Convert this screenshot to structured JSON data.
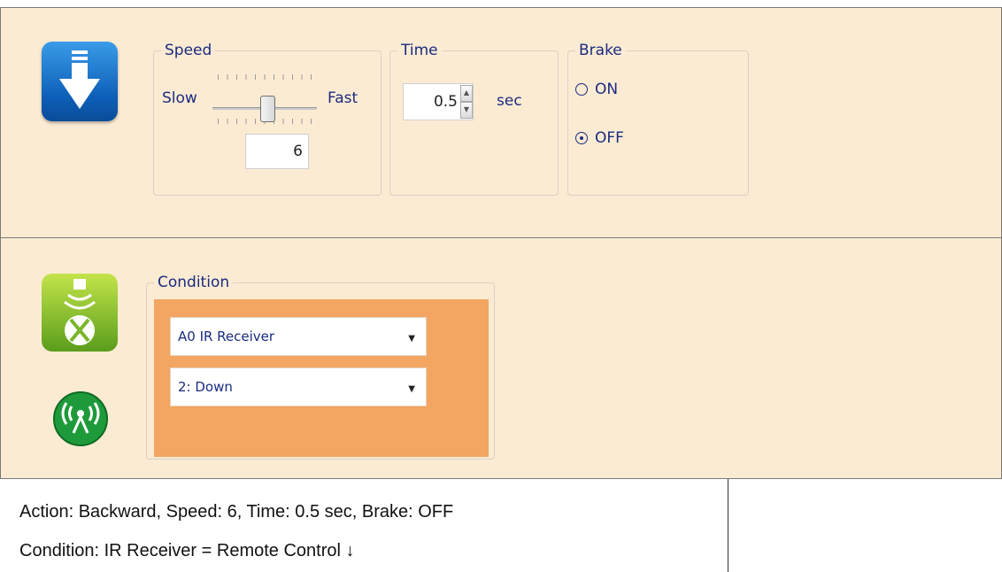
{
  "action_panel": {
    "action_icon": "backward-arrow-icon",
    "speed": {
      "legend": "Speed",
      "slow_label": "Slow",
      "fast_label": "Fast",
      "value": "6",
      "slider_level": 6
    },
    "time": {
      "legend": "Time",
      "value": "0.5",
      "unit": "sec"
    },
    "brake": {
      "legend": "Brake",
      "options": [
        "ON",
        "OFF"
      ],
      "selected": "OFF"
    }
  },
  "condition_panel": {
    "sensor_icon": "ir-receiver-icon",
    "remote_icon": "remote-signal-icon",
    "legend": "Condition",
    "port_select": "A0 IR Receiver",
    "value_select": "2: Down"
  },
  "description": {
    "line1": "Action: Backward, Speed: 6, Time: 0.5 sec, Brake: OFF",
    "line2": "Condition: IR Receiver = Remote Control ↓"
  },
  "colors": {
    "panel_bg": "#fcebd3",
    "condition_bg": "#f3a562",
    "label_text": "#1a2b80",
    "action_icon_blue": "#0d5fb8",
    "sensor_icon_green": "#7fc02c"
  }
}
